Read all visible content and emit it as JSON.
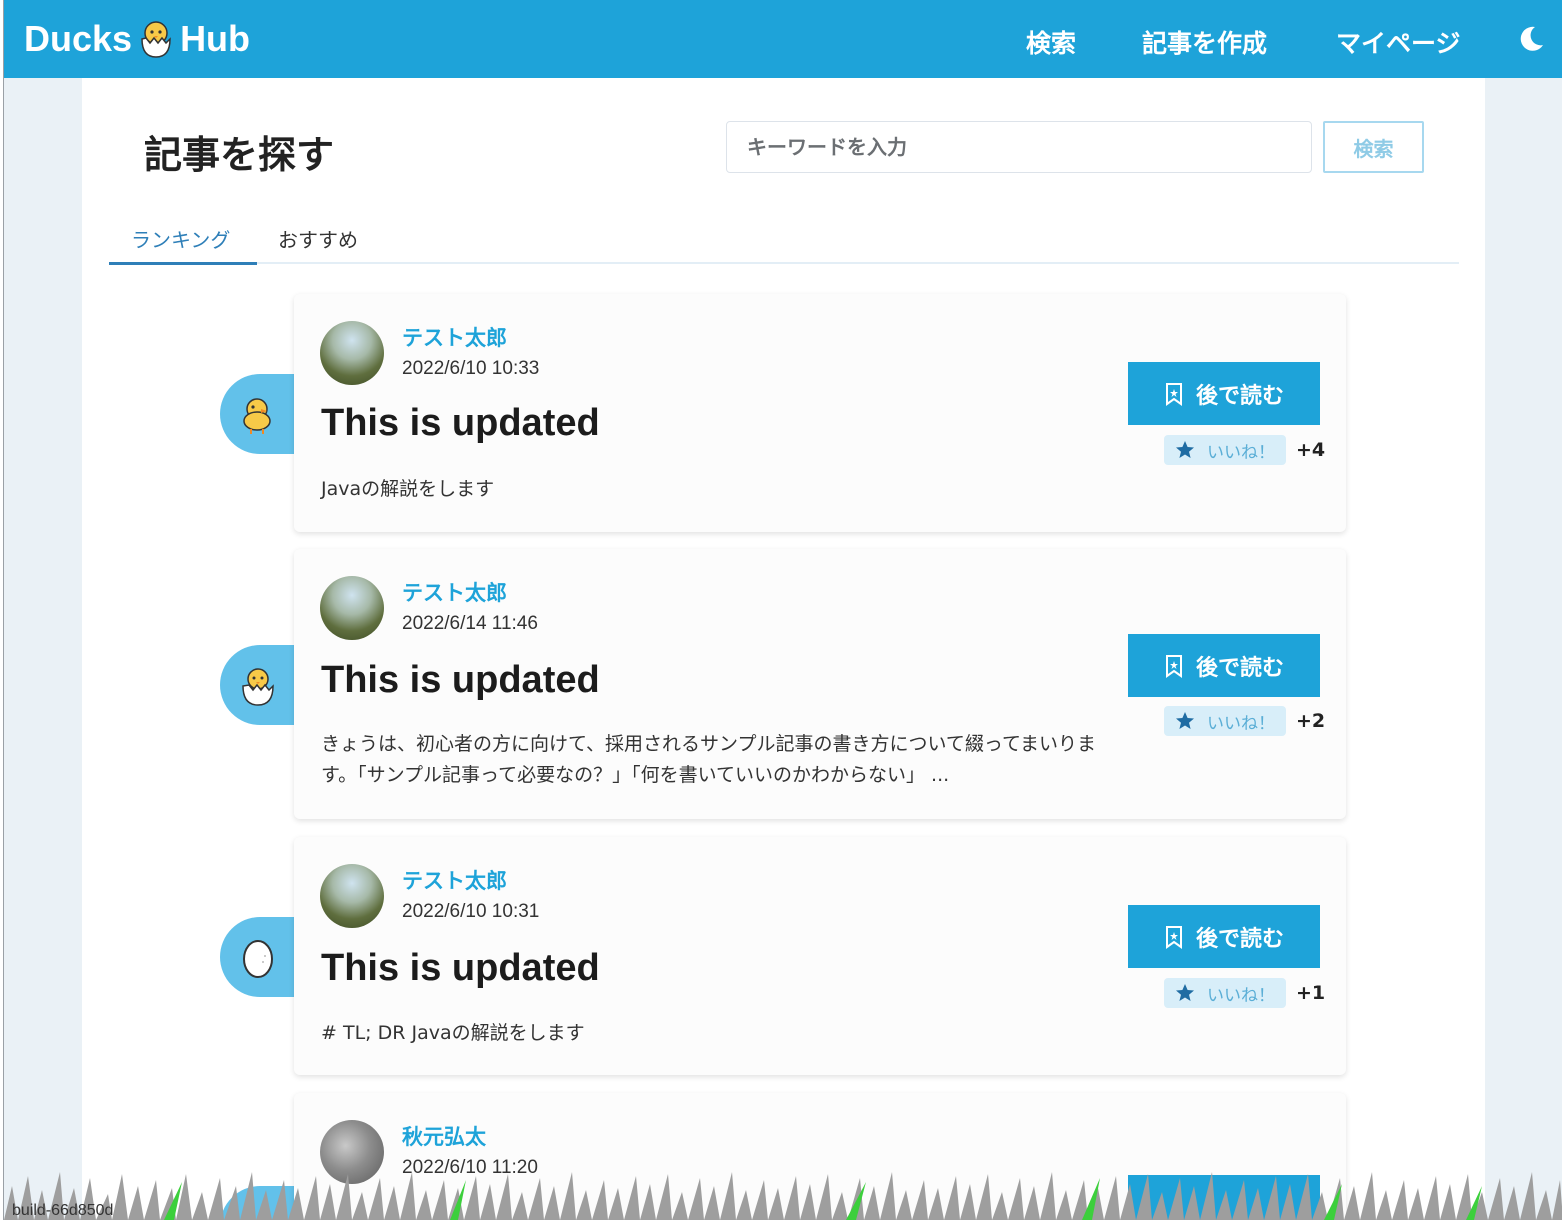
{
  "header": {
    "logo_left": "Ducks",
    "logo_right": "Hub",
    "nav": [
      "検索",
      "記事を作成",
      "マイページ"
    ]
  },
  "search": {
    "page_title": "記事を探す",
    "placeholder": "キーワードを入力",
    "button": "検索"
  },
  "tabs": [
    "ランキング",
    "おすすめ"
  ],
  "articles": [
    {
      "rank_icon": "chick-icon",
      "author": "テスト太郎",
      "date": "2022/6/10 10:33",
      "title": "This is updated",
      "description": "Javaの解説をします",
      "read_later": "後で読む",
      "like_label": "いいね！",
      "like_count": "+4"
    },
    {
      "rank_icon": "hatching-chick-icon",
      "author": "テスト太郎",
      "date": "2022/6/14 11:46",
      "title": "This is updated",
      "description": "きょうは、初心者の方に向けて、採用されるサンプル記事の書き方について綴ってまいります。「サンプル記事って必要なの？」「何を書いていいのかわからない」 ...",
      "read_later": "後で読む",
      "like_label": "いいね！",
      "like_count": "+2"
    },
    {
      "rank_icon": "egg-icon",
      "author": "テスト太郎",
      "date": "2022/6/10 10:31",
      "title": "This is updated",
      "description": "# TL; DR Javaの解説をします",
      "read_later": "後で読む",
      "like_label": "いいね！",
      "like_count": "+1"
    },
    {
      "author": "秋元弘太",
      "date": "2022/6/10 11:20"
    }
  ],
  "footer": {
    "build": "build-66d850d"
  },
  "colors": {
    "brand": "#1ea3d9",
    "badge": "#62c1ea",
    "like_chip": "#d8eef9"
  }
}
